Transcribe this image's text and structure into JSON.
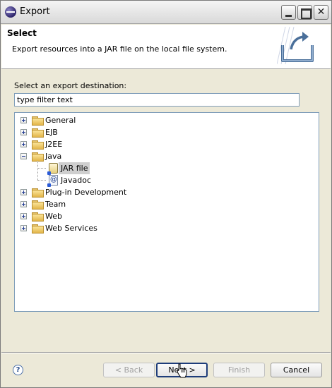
{
  "window": {
    "title": "Export"
  },
  "header": {
    "title": "Select",
    "description": "Export resources into a JAR file on the local file system."
  },
  "main": {
    "prompt": "Select an export destination:",
    "filter_value": "type filter text"
  },
  "tree": {
    "items": [
      {
        "label": "General",
        "expanded": false
      },
      {
        "label": "EJB",
        "expanded": false
      },
      {
        "label": "J2EE",
        "expanded": false
      },
      {
        "label": "Java",
        "expanded": true,
        "children": [
          {
            "label": "JAR file",
            "selected": true,
            "icon": "jar-icon"
          },
          {
            "label": "Javadoc",
            "icon": "javadoc-icon"
          }
        ]
      },
      {
        "label": "Plug-in Development",
        "expanded": false
      },
      {
        "label": "Team",
        "expanded": false
      },
      {
        "label": "Web",
        "expanded": false
      },
      {
        "label": "Web Services",
        "expanded": false
      }
    ]
  },
  "footer": {
    "help_glyph": "?",
    "back_label": "< Back",
    "next_label": "Next >",
    "finish_label": "Finish",
    "cancel_label": "Cancel"
  },
  "colors": {
    "selection": "#cfcfcf",
    "dialog_bg": "#ece9d8",
    "field_border": "#7f9db9",
    "default_button_border": "#1e3d7a"
  }
}
